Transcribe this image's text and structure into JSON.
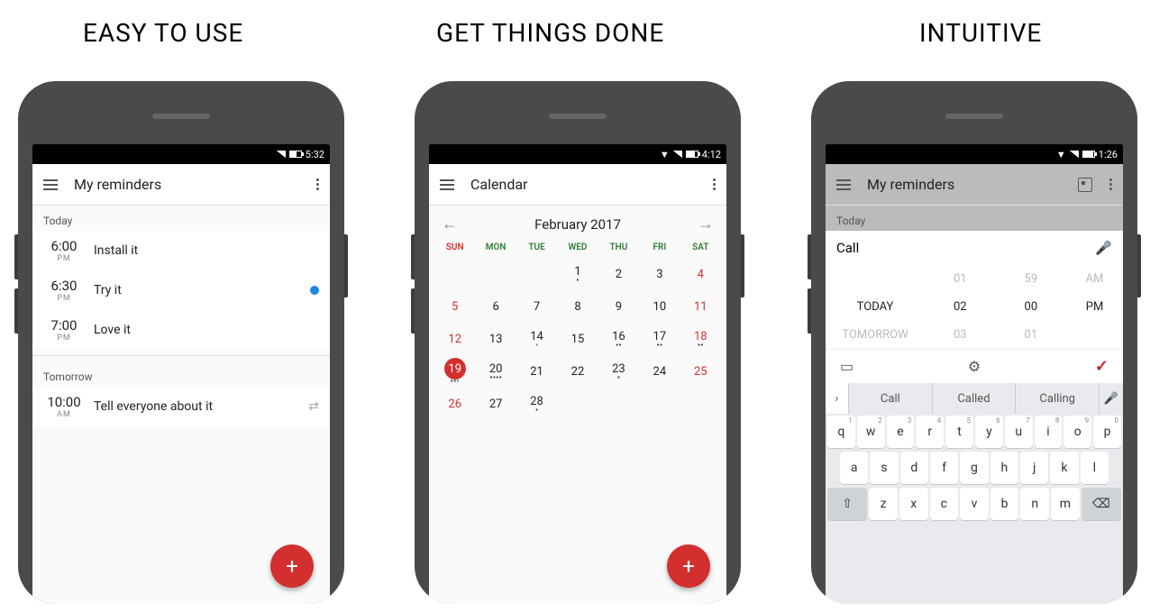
{
  "headings": {
    "h1": "EASY TO USE",
    "h2": "GET THINGS DONE",
    "h3": "INTUITIVE"
  },
  "phone1": {
    "status_time": "5:32",
    "title": "My reminders",
    "sections": {
      "today": "Today",
      "tomorrow": "Tomorrow"
    },
    "reminders_today": [
      {
        "time": "6:00",
        "ampm": "PM",
        "label": "Install it",
        "dot": false
      },
      {
        "time": "6:30",
        "ampm": "PM",
        "label": "Try it",
        "dot": true
      },
      {
        "time": "7:00",
        "ampm": "PM",
        "label": "Love it",
        "dot": false
      }
    ],
    "reminders_tomorrow": [
      {
        "time": "10:00",
        "ampm": "AM",
        "label": "Tell everyone about it",
        "repeat": true
      }
    ]
  },
  "phone2": {
    "status_time": "4:12",
    "title": "Calendar",
    "month": "February 2017",
    "dow": [
      "SUN",
      "MON",
      "TUE",
      "WED",
      "THU",
      "FRI",
      "SAT"
    ],
    "cells": [
      {
        "n": "",
        "red": false
      },
      {
        "n": "",
        "red": false
      },
      {
        "n": "",
        "red": false
      },
      {
        "n": "1",
        "dots": "•"
      },
      {
        "n": "2"
      },
      {
        "n": "3"
      },
      {
        "n": "4",
        "red": true
      },
      {
        "n": "5",
        "red": true
      },
      {
        "n": "6"
      },
      {
        "n": "7"
      },
      {
        "n": "8"
      },
      {
        "n": "9"
      },
      {
        "n": "10"
      },
      {
        "n": "11",
        "red": true
      },
      {
        "n": "12",
        "red": true
      },
      {
        "n": "13"
      },
      {
        "n": "14",
        "dots": "•",
        "blue": true
      },
      {
        "n": "15"
      },
      {
        "n": "16",
        "dots": "••"
      },
      {
        "n": "17",
        "dots": "••"
      },
      {
        "n": "18",
        "red": true,
        "dots": "••"
      },
      {
        "n": "19",
        "red": true,
        "sel": true,
        "dots": "•••",
        "mix": true
      },
      {
        "n": "20",
        "dots": "••••"
      },
      {
        "n": "21"
      },
      {
        "n": "22"
      },
      {
        "n": "23",
        "dots": "•"
      },
      {
        "n": "24"
      },
      {
        "n": "25",
        "red": true
      },
      {
        "n": "26",
        "red": true
      },
      {
        "n": "27"
      },
      {
        "n": "28",
        "dots": "•"
      }
    ]
  },
  "phone3": {
    "status_time": "1:26",
    "title": "My reminders",
    "section": "Today",
    "input_value": "Call",
    "picker": {
      "row_prev": [
        "",
        "01",
        "59",
        "AM"
      ],
      "row_curr": [
        "TODAY",
        "02",
        "00",
        "PM"
      ],
      "row_next": [
        "TOMORROW",
        "03",
        "01",
        ""
      ]
    },
    "suggestions": [
      "Call",
      "Called",
      "Calling"
    ],
    "kb_row1": [
      {
        "k": "q",
        "s": "1"
      },
      {
        "k": "w",
        "s": "2"
      },
      {
        "k": "e",
        "s": "3"
      },
      {
        "k": "r",
        "s": "4"
      },
      {
        "k": "t",
        "s": "5"
      },
      {
        "k": "y",
        "s": "6"
      },
      {
        "k": "u",
        "s": "7"
      },
      {
        "k": "i",
        "s": "8"
      },
      {
        "k": "o",
        "s": "9"
      },
      {
        "k": "p",
        "s": "0"
      }
    ],
    "kb_row2": [
      "a",
      "s",
      "d",
      "f",
      "g",
      "h",
      "j",
      "k",
      "l"
    ],
    "kb_row3": [
      "z",
      "x",
      "c",
      "v",
      "b",
      "n",
      "m"
    ]
  }
}
